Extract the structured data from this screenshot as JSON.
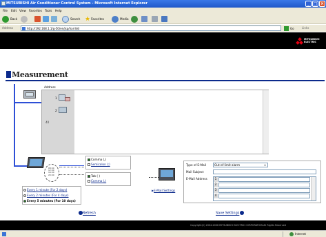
{
  "window": {
    "title": "MITSUBISHI Air Conditioner Control System - Microsoft Internet Explorer"
  },
  "menu": [
    "File",
    "Edit",
    "View",
    "Favorites",
    "Tools",
    "Help"
  ],
  "toolbar": {
    "back": "Back",
    "search": "Search",
    "favorites": "Favorites",
    "media": "Media"
  },
  "address": {
    "label": "Address",
    "url": "http://192.168.1.1/g-50/en/jsp/harrldd",
    "go": "Go",
    "links": "Links"
  },
  "brand": {
    "line1": "MITSUBISHI",
    "line2": "ELECTRIC"
  },
  "page": {
    "title": "Measurement"
  },
  "address_panel": {
    "header": "Address",
    "unit1": "1",
    "unit2": "2",
    "unit3": "40"
  },
  "checkboxes": {
    "cb1": "Comma (,)",
    "cb2": "Semicolon (;)",
    "cb3": "Tab ( )",
    "cb4": "Comma (,)"
  },
  "intervals": {
    "r1": "Every 1 minute (For 2 days)",
    "r2": "Every 2 minutes (For 4 days)",
    "r3": "Every 5 minutes (For 10 days)"
  },
  "email": {
    "link": "E-Mail Settings",
    "type_label": "Type of E-Mail",
    "type_value": "Out-of-limit alarm",
    "subject_label": "Mail Subject",
    "address_label": "E-Mail Address",
    "rows": [
      "1",
      "2",
      "3",
      "4"
    ]
  },
  "actions": {
    "refresh": "Refresh",
    "save": "Save Settings"
  },
  "footer": {
    "copyright": "Copyright(C) 2004-2006 MITSUBISHI ELECTRIC CORPORATION All Rights Reserved"
  },
  "status": {
    "zone": "Internet"
  }
}
